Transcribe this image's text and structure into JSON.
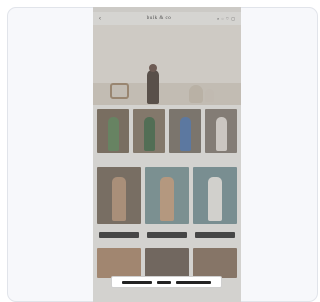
{
  "topbar": {
    "logo_text": "bulk & co",
    "back_icon": "chevron-left-icon",
    "icons": [
      "search-icon",
      "user-icon",
      "heart-icon",
      "bag-icon"
    ]
  },
  "hero": {
    "description": ""
  },
  "products_row1": [
    {
      "text": "",
      "color": "#6b5a46",
      "fig": "#4f7a48"
    },
    {
      "text": "",
      "color": "#7a6a55",
      "fig": "#2f5a35"
    },
    {
      "text": "",
      "color": "#6e6458",
      "fig": "#3f6aa6"
    },
    {
      "text": "",
      "color": "#7a7064",
      "fig": "#e7e0d8"
    }
  ],
  "section": {
    "title": ""
  },
  "products_row2": [
    {
      "text": "",
      "color": "#6a5a4a",
      "fig": "#b38c6b"
    },
    {
      "text": "",
      "color": "#6e8d8f",
      "fig": "#c49a74"
    },
    {
      "text": "",
      "color": "#6b8a8f",
      "fig": "#f0efe9"
    }
  ],
  "bottom_banner": {
    "segments": [
      "",
      "",
      ""
    ]
  }
}
